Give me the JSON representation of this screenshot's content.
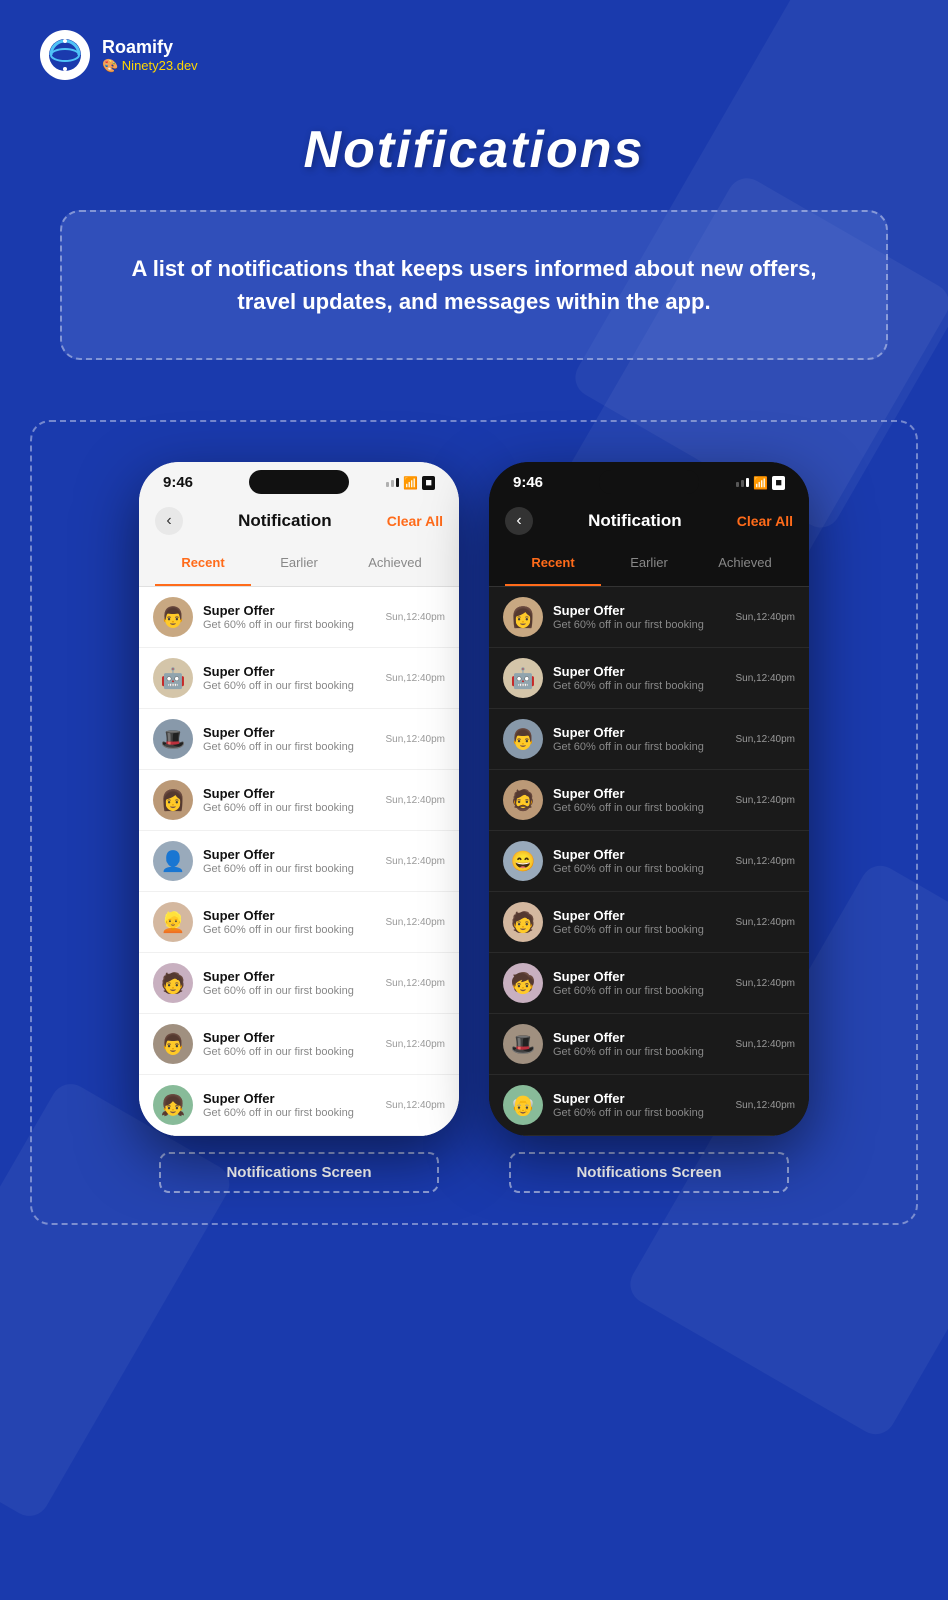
{
  "brand": {
    "name": "Roamify",
    "sub": "🎨 Ninety23.dev",
    "logo_alt": "roamify-logo"
  },
  "page": {
    "title": "Notifications",
    "description": "A list of notifications that keeps users informed about new offers, travel updates, and messages within the app."
  },
  "phone_light": {
    "status_time": "9:46",
    "header_title": "Notification",
    "clear_all": "Clear All",
    "tabs": [
      "Recent",
      "Earlier",
      "Achieved"
    ],
    "active_tab": "Recent",
    "label": "Notifications Screen",
    "notifications": [
      {
        "title": "Super Offer",
        "desc": "Get 60% off in our first booking",
        "time": "Sun,12:40pm",
        "avatar": "👨"
      },
      {
        "title": "Super Offer",
        "desc": "Get 60% off in our first booking",
        "time": "Sun,12:40pm",
        "avatar": "🤖"
      },
      {
        "title": "Super Offer",
        "desc": "Get 60% off in our first booking",
        "time": "Sun,12:40pm",
        "avatar": "🎩"
      },
      {
        "title": "Super Offer",
        "desc": "Get 60% off in our first booking",
        "time": "Sun,12:40pm",
        "avatar": "👩"
      },
      {
        "title": "Super Offer",
        "desc": "Get 60% off in our first booking",
        "time": "Sun,12:40pm",
        "avatar": "👤"
      },
      {
        "title": "Super Offer",
        "desc": "Get 60% off in our first booking",
        "time": "Sun,12:40pm",
        "avatar": "👱"
      },
      {
        "title": "Super Offer",
        "desc": "Get 60% off in our first booking",
        "time": "Sun,12:40pm",
        "avatar": "🧑"
      },
      {
        "title": "Super Offer",
        "desc": "Get 60% off in our first booking",
        "time": "Sun,12:40pm",
        "avatar": "👨"
      },
      {
        "title": "Super Offer",
        "desc": "Get 60% off in our first booking",
        "time": "Sun,12:40pm",
        "avatar": "👧"
      }
    ]
  },
  "phone_dark": {
    "status_time": "9:46",
    "header_title": "Notification",
    "clear_all": "Clear All",
    "tabs": [
      "Recent",
      "Earlier",
      "Achieved"
    ],
    "active_tab": "Recent",
    "label": "Notifications Screen",
    "notifications": [
      {
        "title": "Super Offer",
        "desc": "Get 60% off in our first booking",
        "time": "Sun,12:40pm",
        "avatar": "👩"
      },
      {
        "title": "Super Offer",
        "desc": "Get 60% off in our first booking",
        "time": "Sun,12:40pm",
        "avatar": "🤖"
      },
      {
        "title": "Super Offer",
        "desc": "Get 60% off in our first booking",
        "time": "Sun,12:40pm",
        "avatar": "👨"
      },
      {
        "title": "Super Offer",
        "desc": "Get 60% off in our first booking",
        "time": "Sun,12:40pm",
        "avatar": "🧔"
      },
      {
        "title": "Super Offer",
        "desc": "Get 60% off in our first booking",
        "time": "Sun,12:40pm",
        "avatar": "😄"
      },
      {
        "title": "Super Offer",
        "desc": "Get 60% off in our first booking",
        "time": "Sun,12:40pm",
        "avatar": "🧑"
      },
      {
        "title": "Super Offer",
        "desc": "Get 60% off in our first booking",
        "time": "Sun,12:40pm",
        "avatar": "🧒"
      },
      {
        "title": "Super Offer",
        "desc": "Get 60% off in our first booking",
        "time": "Sun,12:40pm",
        "avatar": "🎩"
      },
      {
        "title": "Super Offer",
        "desc": "Get 60% off in our first booking",
        "time": "Sun,12:40pm",
        "avatar": "👴"
      }
    ]
  }
}
